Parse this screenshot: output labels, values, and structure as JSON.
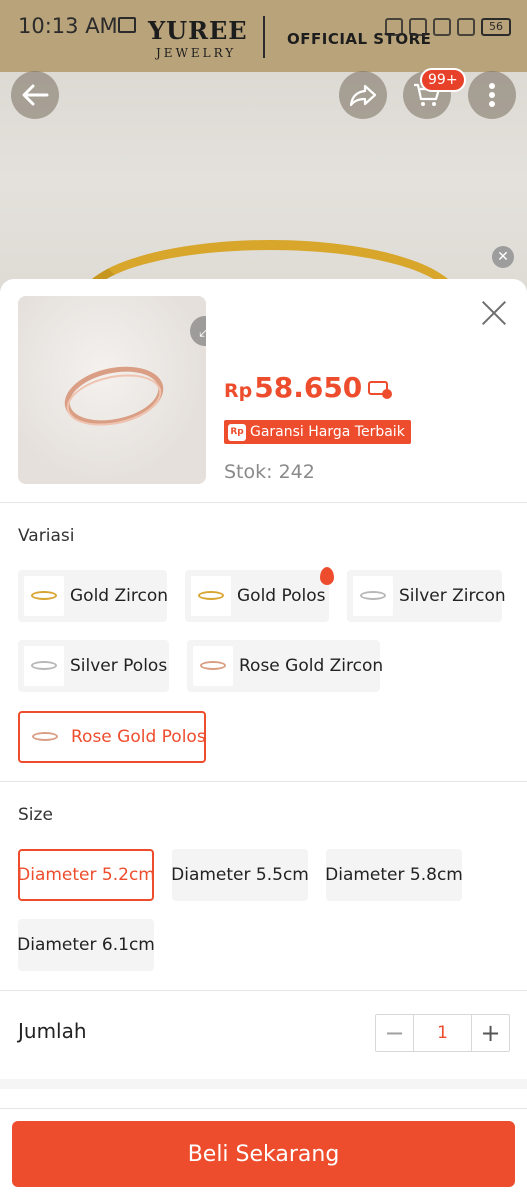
{
  "status_bar": {
    "time": "10:13 AM",
    "battery": "56"
  },
  "brand": {
    "name": "YUREE",
    "sub": "JEWELRY",
    "tag": "OFFICIAL STORE"
  },
  "header": {
    "cart_badge": "99+"
  },
  "product": {
    "currency": "Rp",
    "price": "58.650",
    "guarantee_icon": "Rp",
    "guarantee_label": "Garansi Harga Terbaik",
    "stock": "Stok: 242"
  },
  "variation": {
    "title": "Variasi",
    "options": [
      {
        "label": "Gold Zircon",
        "color": "#d8a531",
        "selected": false
      },
      {
        "label": "Gold Polos",
        "color": "#d8a531",
        "selected": false,
        "hot": true
      },
      {
        "label": "Silver Zircon",
        "color": "#b8b8b8",
        "selected": false
      },
      {
        "label": "Silver Polos",
        "color": "#b8b8b8",
        "selected": false
      },
      {
        "label": "Rose Gold Zircon",
        "color": "#d99e84",
        "selected": false
      },
      {
        "label": "Rose Gold Polos",
        "color": "#d99e84",
        "selected": true
      }
    ]
  },
  "size": {
    "title": "Size",
    "options": [
      {
        "label": "Diameter 5.2cm",
        "selected": true
      },
      {
        "label": "Diameter 5.5cm",
        "selected": false
      },
      {
        "label": "Diameter 5.8cm",
        "selected": false
      },
      {
        "label": "Diameter 6.1cm",
        "selected": false
      }
    ]
  },
  "quantity": {
    "label": "Jumlah",
    "value": "1",
    "minus": "−",
    "plus": "+"
  },
  "cta": {
    "buy_label": "Beli Sekarang"
  },
  "colors": {
    "accent": "#ee4d2d",
    "chip_bg": "#f4f4f4"
  }
}
